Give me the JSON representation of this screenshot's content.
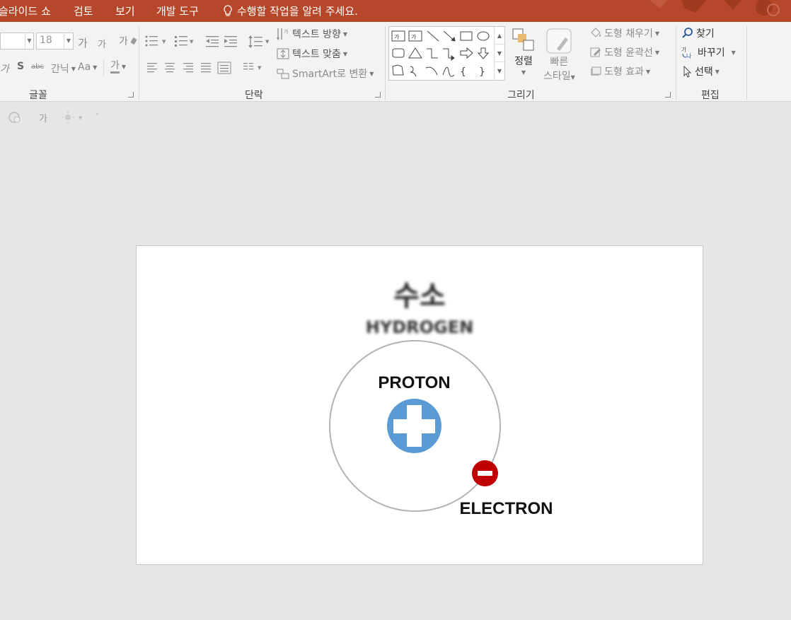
{
  "tabs": [
    {
      "label": "슬라이드 쇼"
    },
    {
      "label": "검토"
    },
    {
      "label": "보기"
    },
    {
      "label": "개발 도구"
    }
  ],
  "tell_me": "수행할 작업을 알려 주세요.",
  "font": {
    "size": "18",
    "grow_label": "가",
    "shrink_label": "가",
    "clear_label": "가",
    "shadow_label": "S",
    "strike_label": "abc",
    "spacing_label": "간닉",
    "case_label": "Aa",
    "color_label": "가",
    "italic_label": "가",
    "group_label": "글꼴"
  },
  "paragraph": {
    "text_direction": "텍스트 방향",
    "align_text": "텍스트 맞춤",
    "smartart": "SmartArt로 변환",
    "group_label": "단락"
  },
  "drawing": {
    "arrange": "정렬",
    "quick_styles_1": "빠른",
    "quick_styles_2": "스타일",
    "shape_fill": "도형 채우기",
    "shape_outline": "도형 윤곽선",
    "shape_effects": "도형 효과",
    "group_label": "그리기"
  },
  "editing": {
    "find": "찾기",
    "replace": "바꾸기",
    "select": "선택",
    "group_label": "편집"
  },
  "qat": {
    "text_label": "가"
  },
  "slide": {
    "title": "수소",
    "subtitle": "HYDROGEN",
    "proton_label": "PROTON",
    "electron_label": "ELECTRON",
    "proton_color": "#5b9bd5",
    "electron_color": "#c00000"
  }
}
